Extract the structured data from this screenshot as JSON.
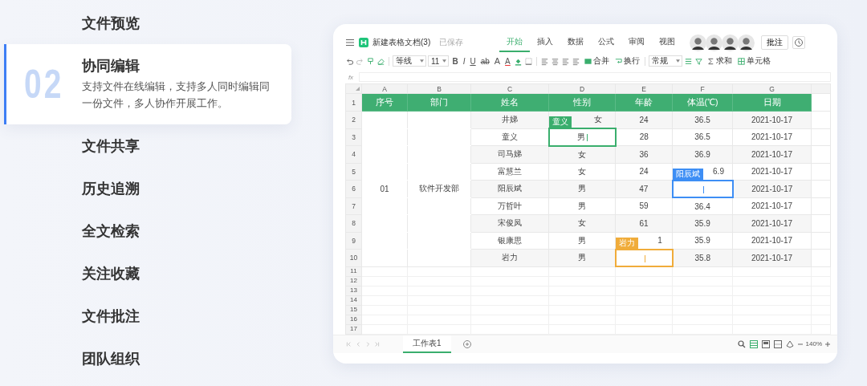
{
  "features": [
    {
      "title": "文件预览",
      "selected": false
    },
    {
      "title": "协同编辑",
      "selected": true,
      "number": "02",
      "description": "支持文件在线编辑，支持多人同时编辑同一份文件，多人协作开展工作。"
    },
    {
      "title": "文件共享",
      "selected": false
    },
    {
      "title": "历史追溯",
      "selected": false
    },
    {
      "title": "全文检索",
      "selected": false
    },
    {
      "title": "关注收藏",
      "selected": false
    },
    {
      "title": "文件批注",
      "selected": false
    },
    {
      "title": "团队组织",
      "selected": false
    }
  ],
  "sheet": {
    "document_title": "新建表格文档(3)",
    "save_status": "已保存",
    "tabs": [
      {
        "label": "开始",
        "selected": true
      },
      {
        "label": "插入",
        "selected": false
      },
      {
        "label": "数据",
        "selected": false
      },
      {
        "label": "公式",
        "selected": false
      },
      {
        "label": "审阅",
        "selected": false
      },
      {
        "label": "视图",
        "selected": false
      }
    ],
    "comment_button": "批注",
    "toolbar": {
      "font": "等线",
      "font_size": "11",
      "format_buttons": [
        {
          "label": "B",
          "kind": "bold"
        },
        {
          "label": "I",
          "kind": "italic"
        },
        {
          "label": "U",
          "kind": "underline"
        },
        {
          "label": "ab",
          "kind": "strike"
        },
        {
          "label": "A",
          "kind": "grow"
        },
        {
          "label": "A",
          "kind": "color"
        }
      ],
      "merge": "合并",
      "wrap": "换行",
      "number_format": "常规",
      "sum": "求和",
      "cell": "单元格"
    },
    "formula_label": "fx",
    "columns": [
      "A",
      "B",
      "C",
      "D",
      "E",
      "F",
      "G"
    ],
    "header_row": {
      "number": "1",
      "cells": [
        "序号",
        "部门",
        "姓名",
        "性别",
        "年龄",
        "体温(℃)",
        "日期"
      ]
    },
    "rows": [
      {
        "number": "2",
        "cells": [
          {
            "kind": "merged"
          },
          {
            "kind": "merged"
          },
          {
            "text": "井娣"
          },
          {
            "text": "女",
            "tag": {
              "name": "童义",
              "color": "#3aae6d"
            }
          },
          {
            "text": "24"
          },
          {
            "text": "36.5"
          },
          {
            "text": "2021-10-17"
          }
        ]
      },
      {
        "number": "3",
        "cells": [
          {
            "kind": "merged"
          },
          {
            "kind": "merged"
          },
          {
            "text": "童义"
          },
          {
            "text": "男",
            "editing": {
              "color": "#3aae6d"
            }
          },
          {
            "text": "28"
          },
          {
            "text": "36.5"
          },
          {
            "text": "2021-10-17"
          }
        ]
      },
      {
        "number": "4",
        "cells": [
          {
            "kind": "merged"
          },
          {
            "kind": "merged"
          },
          {
            "text": "司马娣"
          },
          {
            "text": "女"
          },
          {
            "text": "36"
          },
          {
            "text": "36.9"
          },
          {
            "text": "2021-10-17"
          }
        ]
      },
      {
        "number": "5",
        "cells": [
          {
            "kind": "merged"
          },
          {
            "kind": "merged"
          },
          {
            "text": "富慧兰"
          },
          {
            "text": "女"
          },
          {
            "text": "24"
          },
          {
            "text": "6.9",
            "tag": {
              "name": "阳辰斌",
              "color": "#3d8ef5"
            }
          },
          {
            "text": "2021-10-17"
          }
        ]
      },
      {
        "number": "6",
        "cells": [
          {
            "text": "01",
            "kind": "merged"
          },
          {
            "text": "软件开发部",
            "kind": "merged"
          },
          {
            "text": "阳辰斌"
          },
          {
            "text": "男"
          },
          {
            "text": "47"
          },
          {
            "editing": {
              "color": "#3d8ef5"
            }
          },
          {
            "text": "2021-10-17"
          }
        ]
      },
      {
        "number": "7",
        "cells": [
          {
            "kind": "merged"
          },
          {
            "kind": "merged"
          },
          {
            "text": "万哲叶"
          },
          {
            "text": "男"
          },
          {
            "text": "59"
          },
          {
            "text": "36.4"
          },
          {
            "text": "2021-10-17"
          }
        ]
      },
      {
        "number": "8",
        "cells": [
          {
            "kind": "merged"
          },
          {
            "kind": "merged"
          },
          {
            "text": "宋俊凤"
          },
          {
            "text": "女"
          },
          {
            "text": "61"
          },
          {
            "text": "35.9"
          },
          {
            "text": "2021-10-17"
          }
        ]
      },
      {
        "number": "9",
        "cells": [
          {
            "kind": "merged"
          },
          {
            "kind": "merged"
          },
          {
            "text": "银康思"
          },
          {
            "text": "男"
          },
          {
            "text": "1",
            "tag": {
              "name": "岩力",
              "color": "#f0ac3a"
            }
          },
          {
            "text": "35.9"
          },
          {
            "text": "2021-10-17"
          }
        ]
      },
      {
        "number": "10",
        "cells": [
          {
            "kind": "merged"
          },
          {
            "kind": "merged"
          },
          {
            "text": "岩力"
          },
          {
            "text": "男"
          },
          {
            "editing": {
              "color": "#f0ac3a"
            }
          },
          {
            "text": "35.8"
          },
          {
            "text": "2021-10-17"
          }
        ]
      }
    ],
    "empty_rows": [
      "11",
      "12",
      "13",
      "14",
      "15",
      "16",
      "17"
    ],
    "sheet_tabs": [
      {
        "label": "工作表1",
        "selected": true
      }
    ],
    "zoom": "140%"
  }
}
